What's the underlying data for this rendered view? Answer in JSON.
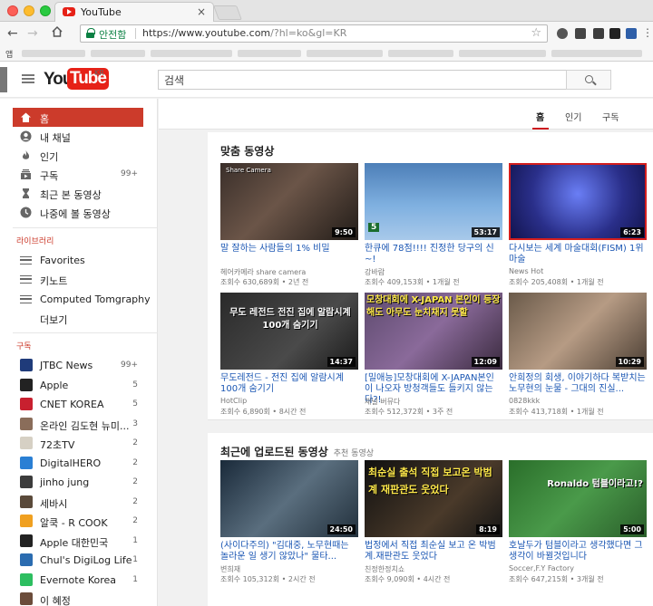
{
  "browser": {
    "tab_title": "YouTube",
    "tab_close": "×",
    "secure_label": "안전함",
    "url_main": "https://www.youtube.com",
    "url_rest": "/?hl=ko&gl=KR",
    "apps_label": "앱"
  },
  "masthead": {
    "logo_you": "You",
    "logo_tube": "Tube",
    "logo_region": "KR",
    "search_placeholder": "검색"
  },
  "guide": {
    "main": [
      {
        "label": "홈",
        "icon": "home-icon",
        "active": true
      },
      {
        "label": "내 채널",
        "icon": "person-icon"
      },
      {
        "label": "인기",
        "icon": "flame-icon"
      },
      {
        "label": "구독",
        "icon": "subscriptions-icon",
        "count": "99+"
      },
      {
        "label": "최근 본 동영상",
        "icon": "hourglass-icon"
      },
      {
        "label": "나중에 볼 동영상",
        "icon": "clock-icon"
      }
    ],
    "library_heading": "라이브러리",
    "library": [
      {
        "label": "Favorites"
      },
      {
        "label": "키노트"
      },
      {
        "label": "Computed Tomgraphy"
      }
    ],
    "more_label": "더보기",
    "subs_heading": "구독",
    "subscriptions": [
      {
        "label": "JTBC News",
        "count": "99+",
        "color": "#1f3b7a"
      },
      {
        "label": "Apple",
        "count": "5",
        "color": "#222222"
      },
      {
        "label": "CNET KOREA",
        "count": "5",
        "color": "#c8202f"
      },
      {
        "label": "온라인 김도현 뉴미...",
        "count": "3",
        "color": "#8a6d5a"
      },
      {
        "label": "72초TV",
        "count": "2",
        "color": "#d6d0c4"
      },
      {
        "label": "DigitalHERO",
        "count": "2",
        "color": "#2a7fd4"
      },
      {
        "label": "jinho jung",
        "count": "2",
        "color": "#3c3c3c"
      },
      {
        "label": "세바시",
        "count": "2",
        "color": "#5a4a3a"
      },
      {
        "label": "알쿡 - R COOK",
        "count": "2",
        "color": "#f0a020"
      },
      {
        "label": "Apple 대한민국",
        "count": "1",
        "color": "#222222"
      },
      {
        "label": "Chul's DigiLog Life",
        "count": "1",
        "color": "#2b6cb0"
      },
      {
        "label": "Evernote Korea",
        "count": "1",
        "color": "#2dbe60"
      },
      {
        "label": "이 혜정",
        "count": "",
        "color": "#6b4c3a"
      }
    ]
  },
  "feed_tabs": [
    {
      "label": "홈",
      "active": true
    },
    {
      "label": "인기"
    },
    {
      "label": "구독"
    }
  ],
  "shelf1": {
    "title": "맞춤 동영상",
    "videos": [
      {
        "title": "말 잘하는 사람들의 1% 비밀",
        "channel": "헤어카메라 share camera",
        "meta": "조회수 630,689회 • 2년 전",
        "duration": "9:50",
        "caption": "Share Camera"
      },
      {
        "title": "한큐에 78점!!!! 진정한 당구의 신~!",
        "channel": "강바람",
        "meta": "조회수 409,153회 • 1개월 전",
        "duration": "53:17",
        "caption": "5"
      },
      {
        "title": "다시보는 세계 마술대회(FISM) 1위 마술",
        "channel": "News Hot",
        "meta": "조회수 205,408회 • 1개월 전",
        "duration": "6:23",
        "caption": ""
      },
      {
        "title": "무도레전드 - 전진 집에 알람시계 100개 숨기기",
        "channel": "HotClip",
        "meta": "조회수 6,890회 • 8시간 전",
        "duration": "14:37",
        "caption": "무도 레전드 전진 집에 알람시계 100개 숨기기"
      },
      {
        "title": "[밀애능]모창대회에 X-JAPAN본인이 나오자 방청객들도 들키지 않는다?!",
        "channel": "채널 버뮤다",
        "meta": "조회수 512,372회 • 3주 전",
        "duration": "12:09",
        "caption": "모창대회에 X-JAPAN 본인이 등장해도 아무도 눈치채지 못할"
      },
      {
        "title": "안희정의 회생, 이야기하다 복받치는 노무현의 눈물 - 그대의 진실...",
        "channel": "0828kkk",
        "meta": "조회수 413,718회 • 1개월 전",
        "duration": "10:29",
        "caption": ""
      }
    ]
  },
  "shelf2": {
    "title": "최근에 업로드된 동영상",
    "subtitle": "추천 동영상",
    "videos": [
      {
        "title": "(사이다주의) \"김대중, 노무현때는 놀라운 일 생기 않았나\" 물타...",
        "channel": "변희재",
        "meta": "조회수 105,312회 • 2시간 전",
        "duration": "24:50",
        "caption": ""
      },
      {
        "title": "법정에서 직접 최순실 보고 온 박범계.재판관도 웃었다",
        "channel": "친정한정치쇼",
        "meta": "조회수 9,090회 • 4시간 전",
        "duration": "8:19",
        "caption": "최순실 출석 직접 보고온 박범계 재판관도 웃었다"
      },
      {
        "title": "호날두가 텀블이라고 생각했다면 그 생각이 바뀔것입니다",
        "channel": "Soccer,F.Y Factory",
        "meta": "조회수 647,215회 • 3개월 전",
        "duration": "5:00",
        "caption": "Ronaldo 텀블이라고!?"
      }
    ]
  }
}
